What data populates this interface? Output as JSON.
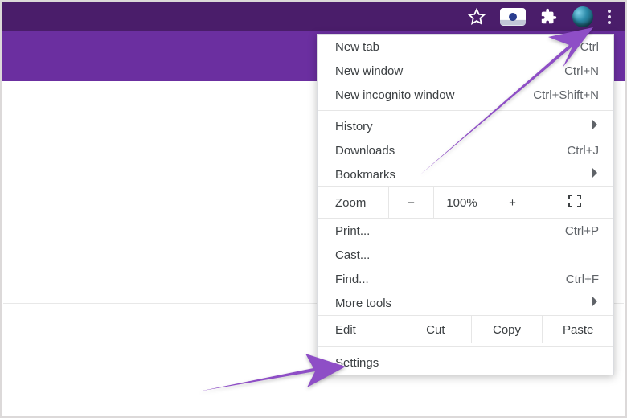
{
  "toolbar": {
    "icons": {
      "star": "star-icon",
      "camera": "camera-extension-icon",
      "puzzle": "extensions-icon",
      "avatar": "profile-avatar",
      "menu": "more-menu-icon"
    }
  },
  "menu": {
    "new_tab": {
      "label": "New tab",
      "shortcut": "Ctrl"
    },
    "new_window": {
      "label": "New window",
      "shortcut": "Ctrl+N"
    },
    "incognito": {
      "label": "New incognito window",
      "shortcut": "Ctrl+Shift+N"
    },
    "history": {
      "label": "History"
    },
    "downloads": {
      "label": "Downloads",
      "shortcut": "Ctrl+J"
    },
    "bookmarks": {
      "label": "Bookmarks"
    },
    "zoom": {
      "label": "Zoom",
      "minus": "−",
      "value": "100%",
      "plus": "+"
    },
    "print": {
      "label": "Print...",
      "shortcut": "Ctrl+P"
    },
    "cast": {
      "label": "Cast..."
    },
    "find": {
      "label": "Find...",
      "shortcut": "Ctrl+F"
    },
    "more_tools": {
      "label": "More tools"
    },
    "edit": {
      "label": "Edit",
      "cut": "Cut",
      "copy": "Copy",
      "paste": "Paste"
    },
    "settings": {
      "label": "Settings"
    }
  }
}
